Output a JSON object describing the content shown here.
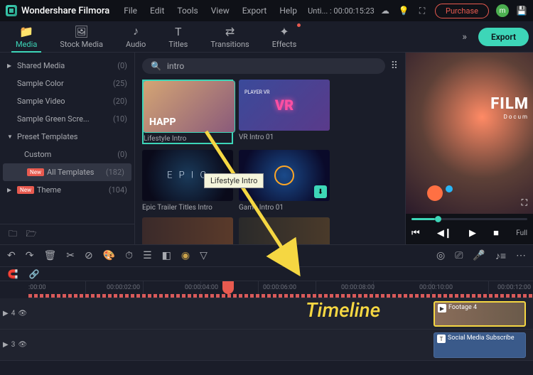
{
  "titlebar": {
    "app": "Wondershare Filmora",
    "menus": [
      "File",
      "Edit",
      "Tools",
      "View",
      "Export",
      "Help"
    ],
    "project": "Unti... : 00:00:15:23",
    "purchase": "Purchase",
    "avatar_initial": "m"
  },
  "ribbon": {
    "tabs": [
      {
        "label": "Media",
        "icon": "📁"
      },
      {
        "label": "Stock Media",
        "icon": "🖼"
      },
      {
        "label": "Audio",
        "icon": "♪"
      },
      {
        "label": "Titles",
        "icon": "T"
      },
      {
        "label": "Transitions",
        "icon": "⇄"
      },
      {
        "label": "Effects",
        "icon": "✦"
      }
    ],
    "export": "Export"
  },
  "sidebar": {
    "items": [
      {
        "name": "Shared Media",
        "count": "(0)",
        "chev": "▶"
      },
      {
        "name": "Sample Color",
        "count": "(25)"
      },
      {
        "name": "Sample Video",
        "count": "(20)"
      },
      {
        "name": "Sample Green Scre...",
        "count": "(10)"
      },
      {
        "name": "Preset Templates",
        "count": "",
        "chev": "▼"
      },
      {
        "name": "Custom",
        "count": "(0)",
        "indent": true
      },
      {
        "name": "All Templates",
        "count": "(182)",
        "indent": true,
        "selected": true,
        "new": true
      },
      {
        "name": "Theme",
        "count": "(104)",
        "chev": "▶",
        "new": true
      }
    ]
  },
  "search": {
    "value": "intro"
  },
  "thumbs": [
    {
      "label": "Lifestyle Intro",
      "cls": "t1",
      "drag": true
    },
    {
      "label": "VR Intro 01",
      "cls": "t2"
    },
    {
      "label": "Epic Trailer Titles Intro",
      "cls": "t3"
    },
    {
      "label": "Game Intro 01",
      "cls": "t4",
      "dl": true
    },
    {
      "label": "",
      "cls": "t5"
    },
    {
      "label": "",
      "cls": "t6"
    }
  ],
  "tooltip": "Lifestyle Intro",
  "preview": {
    "title": "FILM",
    "subtitle": "Docum",
    "full": "Full"
  },
  "ruler": {
    "times": [
      ":00:00",
      "00:00:02:00",
      "00:00:04:00",
      "00:00:06:00",
      "00:00:08:00",
      "00:00:10:00",
      "00:00:12:00"
    ]
  },
  "tracks": {
    "v1": {
      "label": "4",
      "clip": "Footage 4"
    },
    "t1": {
      "label": "3",
      "clip": "Social Media Subscribe"
    }
  },
  "annotation": "Timeline",
  "badge_new": "New"
}
